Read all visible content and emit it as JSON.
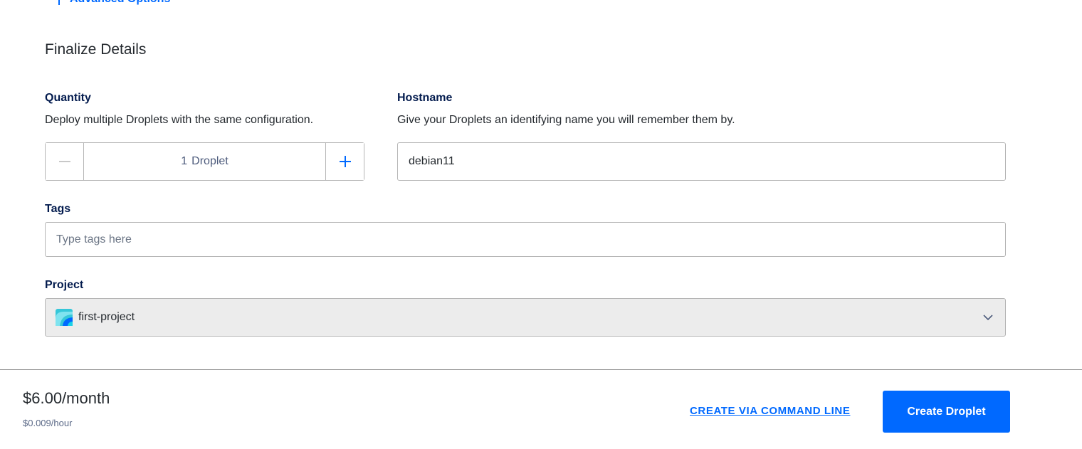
{
  "advanced_options": {
    "label": "Advanced Options"
  },
  "finalize": {
    "title": "Finalize Details",
    "quantity": {
      "label": "Quantity",
      "description": "Deploy multiple Droplets with the same configuration.",
      "count": "1",
      "unit": "Droplet",
      "minus_icon": "minus-icon",
      "plus_icon": "plus-icon"
    },
    "hostname": {
      "label": "Hostname",
      "description": "Give your Droplets an identifying name you will remember them by.",
      "value": "debian11"
    },
    "tags": {
      "label": "Tags",
      "placeholder": "Type tags here",
      "value": ""
    },
    "project": {
      "label": "Project",
      "selected": "first-project",
      "icon": "project-icon",
      "chevron_icon": "chevron-down-icon"
    }
  },
  "footer": {
    "price_monthly": "$6.00/month",
    "price_hourly": "$0.009/hour",
    "cli_link": "CREATE VIA COMMAND LINE",
    "create_button": "Create Droplet"
  },
  "colors": {
    "accent": "#0069ff",
    "heading": "#031b4e",
    "border": "#b5b5b5",
    "select_bg": "#ececec"
  }
}
